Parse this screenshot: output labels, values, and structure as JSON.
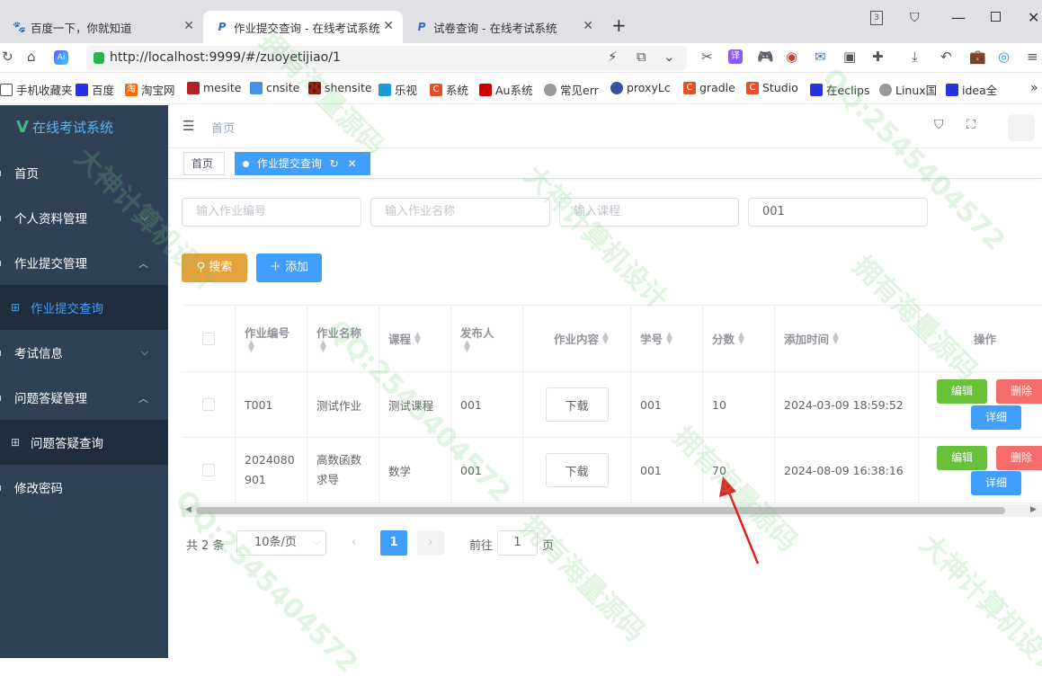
{
  "browser": {
    "tabs": [
      {
        "title": "百度一下，你就知道",
        "icon": "baidu-icon"
      },
      {
        "title": "作业提交查询 - 在线考试系统",
        "icon": "p-icon"
      },
      {
        "title": "试卷查询 - 在线考试系统",
        "icon": "p-icon"
      }
    ],
    "new_tab": "+",
    "url": "http://localhost:9999/#/zuoyetijiao/1",
    "bookmarks": [
      "手机收藏夹",
      "百度",
      "淘宝网",
      "mesite",
      "cnsite",
      "shensite",
      "乐视",
      "系统",
      "Au系统",
      "常见err",
      "proxyLc",
      "gradle",
      "Studio",
      "在eclips",
      "Linux国",
      "idea全"
    ],
    "bookmarks_more": "»"
  },
  "sidebar": {
    "logo_mark": "V",
    "logo_text": "在线考试系统",
    "items": [
      {
        "label": "首页"
      },
      {
        "label": "个人资料管理",
        "arrow": "⌵"
      },
      {
        "label": "作业提交管理",
        "arrow": "︿"
      },
      {
        "label": "作业提交查询"
      },
      {
        "label": "考试信息",
        "arrow": "⌵"
      },
      {
        "label": "问题答疑管理",
        "arrow": "︿"
      },
      {
        "label": "问题答疑查询"
      },
      {
        "label": "修改密码"
      }
    ]
  },
  "navbar": {
    "breadcrumb": "首页"
  },
  "tags": {
    "home": "首页",
    "active": "作业提交查询"
  },
  "filters": {
    "homework_no_placeholder": "输入作业编号",
    "homework_name_placeholder": "输入作业名称",
    "course_placeholder": "输入课程",
    "student_value": "001",
    "search_label": "搜索",
    "add_label": "添加"
  },
  "table": {
    "headers": [
      "作业编号",
      "作业名称",
      "课程",
      "发布人",
      "作业内容",
      "学号",
      "分数",
      "添加时间",
      "操作"
    ],
    "rows": [
      {
        "no": "T001",
        "name": "测试作业",
        "course": "测试课程",
        "publisher": "001",
        "content": "下载",
        "student_no": "001",
        "score": "10",
        "time": "2024-03-09 18:59:52"
      },
      {
        "no": "2024080901",
        "name": "高数函数求导",
        "course": "数学",
        "publisher": "001",
        "content": "下载",
        "student_no": "001",
        "score": "70",
        "time": "2024-08-09 16:38:16"
      }
    ],
    "actions": {
      "edit": "编辑",
      "delete": "删除",
      "detail": "详细"
    }
  },
  "pagination": {
    "total": "共 2 条",
    "page_size": "10条/页",
    "current": "1",
    "goto_prefix": "前往",
    "goto_value": "1",
    "goto_suffix": "页"
  },
  "watermarks": [
    "大神计算机设计",
    "拥有海量源码",
    "QQ:2545404572"
  ],
  "colors": {
    "sidebar": "#304156",
    "primary": "#409eff",
    "search": "#e6a23c",
    "success": "#67c23a",
    "danger": "#f56c6c",
    "arrow": "#e02020"
  }
}
